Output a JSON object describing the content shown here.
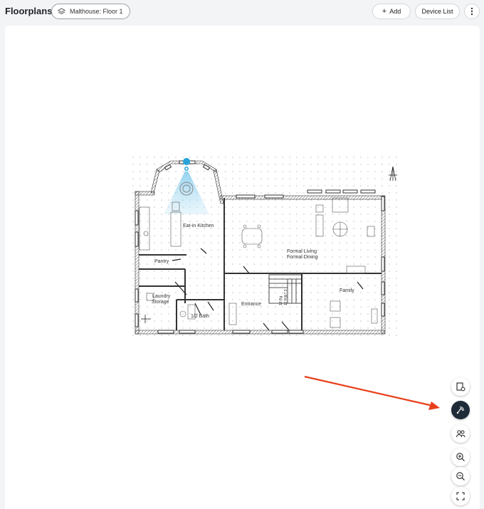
{
  "header": {
    "title": "Floorplans",
    "floor_selector": "Malthouse: Floor 1",
    "add_label": "Add",
    "device_list_label": "Device List",
    "more_icon": "vertical-dots-icon"
  },
  "floorplan": {
    "rooms": {
      "kitchen": "Eat-in Kitchen",
      "pantry": "Pantry",
      "laundry_line1": "Laundry",
      "laundry_line2": "Storage",
      "bath": "1/2 Bath",
      "entrance": "Entrance",
      "formal_line1": "Formal Living",
      "formal_line2": "Formal Dining",
      "family": "Family"
    },
    "stair_text_line1": "18 Rg",
    "stair_text_line2": "17 R@7.3"
  },
  "toolbar": {
    "tools": [
      {
        "icon": "floor-settings-icon",
        "active": false
      },
      {
        "icon": "wifi-heatmap-icon",
        "active": true
      },
      {
        "icon": "people-icon",
        "active": false
      },
      {
        "icon": "zoom-in-icon",
        "active": false
      },
      {
        "icon": "zoom-out-icon",
        "active": false
      },
      {
        "icon": "fit-screen-icon",
        "active": false
      }
    ]
  },
  "colors": {
    "accent_dark": "#1e2a37",
    "annotation_arrow": "#e8401c",
    "device_blue": "#29a3d9"
  }
}
